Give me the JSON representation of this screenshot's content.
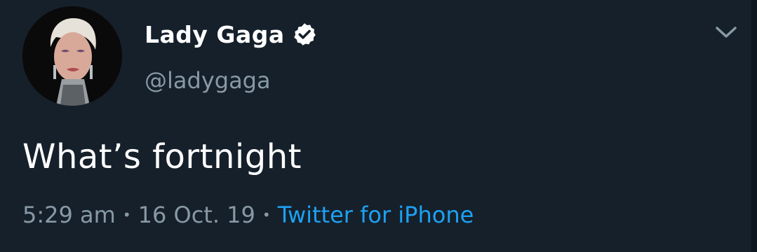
{
  "author": {
    "display_name": "Lady Gaga",
    "handle": "@ladygaga",
    "verified": true,
    "verified_icon": "verified-badge-icon",
    "avatar": "profile-photo"
  },
  "tweet": {
    "text": "What’s fortnight",
    "time": "5:29 am",
    "separator": "•",
    "date": "16 Oct. 19",
    "source": "Twitter for iPhone"
  },
  "menu": {
    "icon": "chevron-down-icon"
  },
  "colors": {
    "background": "#15202b",
    "primary_text": "#ffffff",
    "secondary_text": "#8899a6",
    "link": "#1da1f2"
  }
}
